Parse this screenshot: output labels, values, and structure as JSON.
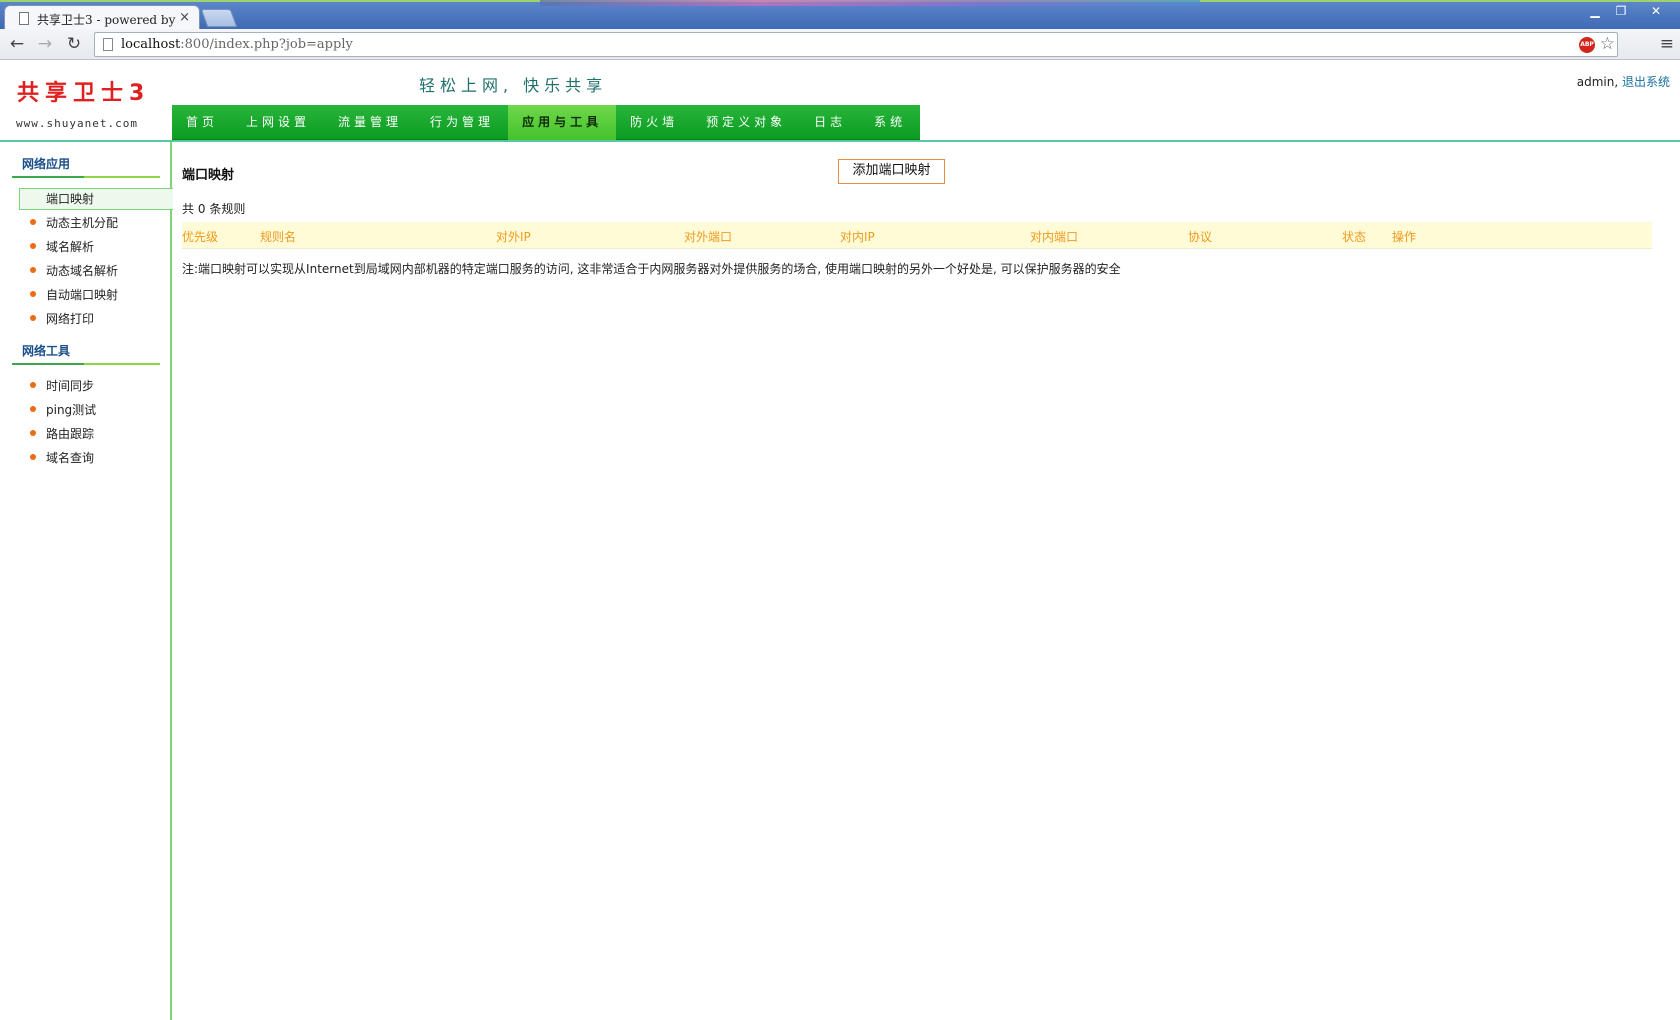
{
  "browser": {
    "tab_title": "共享卫士3 - powered by",
    "tab_close": "×",
    "url_host": "localhost",
    "url_rest": ":800/index.php?job=apply",
    "window_controls": {
      "minimize": "▁",
      "maximize": "❐",
      "close": "✕"
    },
    "abp_label": "ABP"
  },
  "header": {
    "logo": "共享卫士3",
    "logo_url": "www.shuyanet.com",
    "slogan": "轻松上网, 快乐共享",
    "user": "admin,",
    "logout": "退出系统"
  },
  "mainnav": [
    {
      "label": "首页"
    },
    {
      "label": "上网设置"
    },
    {
      "label": "流量管理"
    },
    {
      "label": "行为管理"
    },
    {
      "label": "应用与工具",
      "active": true
    },
    {
      "label": "防火墙"
    },
    {
      "label": "预定义对象"
    },
    {
      "label": "日志"
    },
    {
      "label": "系统"
    }
  ],
  "sidebar": {
    "sections": [
      {
        "title": "网络应用",
        "items": [
          {
            "label": "端口映射",
            "selected": true
          },
          {
            "label": "动态主机分配"
          },
          {
            "label": "域名解析"
          },
          {
            "label": "动态域名解析"
          },
          {
            "label": "自动端口映射"
          },
          {
            "label": "网络打印"
          }
        ]
      },
      {
        "title": "网络工具",
        "items": [
          {
            "label": "时间同步"
          },
          {
            "label": "ping测试"
          },
          {
            "label": "路由跟踪"
          },
          {
            "label": "域名查询"
          }
        ]
      }
    ]
  },
  "content": {
    "title": "端口映射",
    "add_button": "添加端口映射",
    "count_prefix": "共",
    "count": "0",
    "count_suffix": "条规则",
    "columns": [
      "优先级",
      "规则名",
      "对外IP",
      "对外端口",
      "对内IP",
      "对内端口",
      "协议",
      "状态",
      "操作"
    ],
    "note": "注:端口映射可以实现从Internet到局域网内部机器的特定端口服务的访问, 这非常适合于内网服务器对外提供服务的场合, 使用端口映射的另外一个好处是, 可以保护服务器的安全"
  },
  "colors": {
    "nav_green": "#0d9c22",
    "nav_active": "#45c22d",
    "logo_red": "#e02020",
    "table_header_bg": "#fffbd6",
    "table_header_text": "#f09a20",
    "bullet": "#f06a14"
  }
}
